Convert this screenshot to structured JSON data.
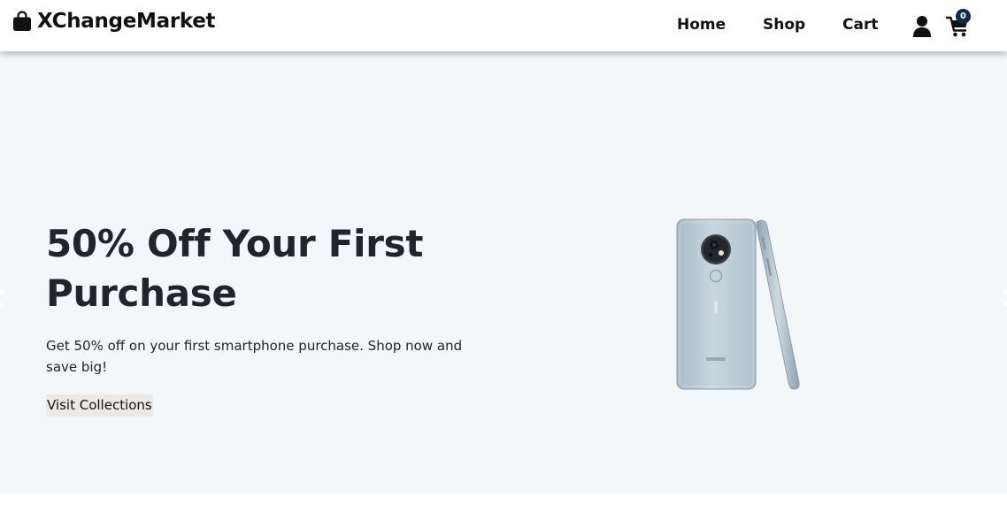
{
  "header": {
    "brand": "XChangeMarket",
    "brand_icon": "shopping-bag-icon",
    "nav": {
      "home": "Home",
      "shop": "Shop",
      "cart": "Cart"
    },
    "user_icon": "user-icon",
    "cart_icon": "shopping-cart-icon",
    "cart_count": "0"
  },
  "hero": {
    "title": "50% Off Your First Purchase",
    "text": "Get 50% off on your first smartphone purchase. Shop now and save big!",
    "cta": "Visit Collections",
    "image": "smartphone-product-image",
    "prev_icon": "chevron-left-icon",
    "next_icon": "chevron-right-icon"
  },
  "colors": {
    "hero_background": "#f3f7fa",
    "badge": "#10284a",
    "text": "#212529"
  }
}
